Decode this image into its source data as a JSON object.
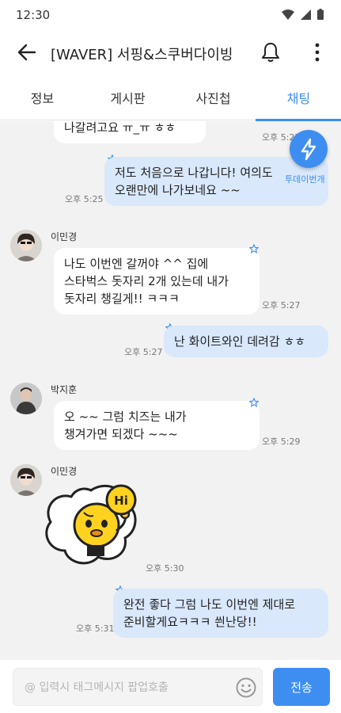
{
  "status_bar": {
    "time": "12:30"
  },
  "app_bar": {
    "title": "[WAVER] 서핑&스쿠버다이빙"
  },
  "tabs": [
    {
      "label": "정보"
    },
    {
      "label": "게시판"
    },
    {
      "label": "사진첩"
    },
    {
      "label": "채팅",
      "active": true
    }
  ],
  "fab": {
    "label": "투데이번개"
  },
  "messages": [
    {
      "id": "m1",
      "direction": "in",
      "text": "나갈려고요 ㅠ_ㅠ ㅎㅎ",
      "time": "오후 5:27"
    },
    {
      "id": "m2",
      "direction": "out",
      "text": "저도 처음으로 나갑니다! 여의도\n오랜만에 나가보네요 ~~",
      "time": "오후 5:25"
    },
    {
      "id": "m3",
      "direction": "in",
      "sender": "이민경",
      "text": "나도 이번엔 갈꺼야 ^^ 집에\n스타벅스 돗자리 2개 있는데 내가\n돗자리 챙길게!! ㅋㅋㅋ",
      "time": "오후 5:27"
    },
    {
      "id": "m4",
      "direction": "out",
      "text": "난 화이트와인 데려감 ㅎㅎ",
      "time": "오후 5:27"
    },
    {
      "id": "m5",
      "direction": "in",
      "sender": "박지훈",
      "text": "오 ~~ 그럼 치즈는 내가\n챙겨가면 되겠다 ~~~",
      "time": "오후 5:29"
    },
    {
      "id": "m6",
      "direction": "in",
      "sender": "이민경",
      "sticker": "Hi",
      "time": "오후 5:30"
    },
    {
      "id": "m7",
      "direction": "out",
      "text": "완전 좋다 그럼 나도 이번엔 제대로\n준비할게요ㅋㅋㅋ 씐난당!!",
      "time": "오후 5:31"
    }
  ],
  "composer": {
    "placeholder": "@ 입력시 태그메시지 팝업호출",
    "send_label": "전송"
  },
  "colors": {
    "accent": "#3d8ef0",
    "outgoing_bubble": "#d9e8fb",
    "incoming_bubble": "#ffffff",
    "chat_background": "#f2f2f2"
  }
}
